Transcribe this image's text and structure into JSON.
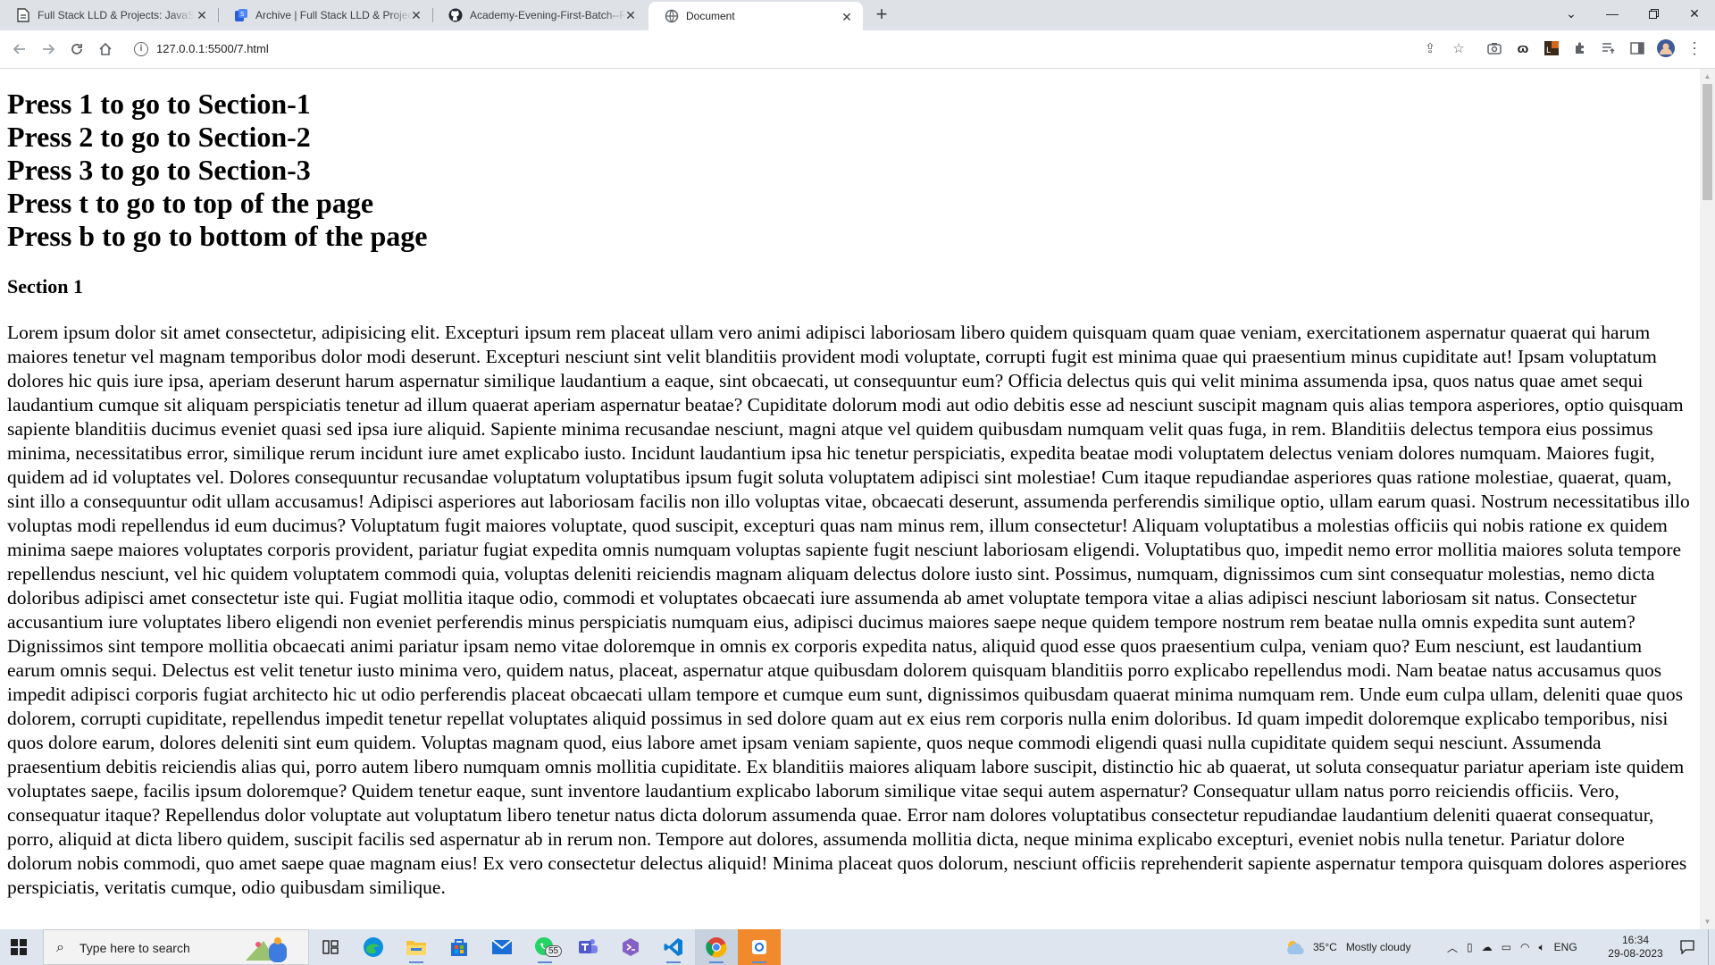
{
  "browser": {
    "tabs": [
      {
        "title": "Full Stack LLD & Projects: JavaScript",
        "icon": "document-icon",
        "active": false
      },
      {
        "title": "Archive | Full Stack LLD & Projects",
        "icon": "app-icon",
        "active": false
      },
      {
        "title": "Academy-Evening-First-Batch--Full",
        "icon": "github-icon",
        "active": false
      },
      {
        "title": "Document",
        "icon": "globe-icon",
        "active": true
      }
    ],
    "url": "127.0.0.1:5500/7.html"
  },
  "page": {
    "headings": [
      "Press 1 to go to Section-1",
      "Press 2 to go to Section-2",
      "Press 3 to go to Section-3",
      "Press t to go to top of the page",
      "Press b to go to bottom of the page"
    ],
    "section_title": "Section 1",
    "section_text": "Lorem ipsum dolor sit amet consectetur, adipisicing elit. Excepturi ipsum rem placeat ullam vero animi adipisci laboriosam libero quidem quisquam quam quae veniam, exercitationem aspernatur quaerat qui harum maiores tenetur vel magnam temporibus dolor modi deserunt. Excepturi nesciunt sint velit blanditiis provident modi voluptate, corrupti fugit est minima quae qui praesentium minus cupiditate aut! Ipsam voluptatum dolores hic quis iure ipsa, aperiam deserunt harum aspernatur similique laudantium a eaque, sint obcaecati, ut consequuntur eum? Officia delectus quis qui velit minima assumenda ipsa, quos natus quae amet sequi laudantium cumque sit aliquam perspiciatis tenetur ad illum quaerat aperiam aspernatur beatae? Cupiditate dolorum modi aut odio debitis esse ad nesciunt suscipit magnam quis alias tempora asperiores, optio quisquam sapiente blanditiis ducimus eveniet quasi sed ipsa iure aliquid. Sapiente minima recusandae nesciunt, magni atque vel quidem quibusdam numquam velit quas fuga, in rem. Blanditiis delectus tempora eius possimus minima, necessitatibus error, similique rerum incidunt iure amet explicabo iusto. Incidunt laudantium ipsa hic tenetur perspiciatis, expedita beatae modi voluptatem delectus veniam dolores numquam. Maiores fugit, quidem ad id voluptates vel. Dolores consequuntur recusandae voluptatum voluptatibus ipsum fugit soluta voluptatem adipisci sint molestiae! Cum itaque repudiandae asperiores quas ratione molestiae, quaerat, quam, sint illo a consequuntur odit ullam accusamus! Adipisci asperiores aut laboriosam facilis non illo voluptas vitae, obcaecati deserunt, assumenda perferendis similique optio, ullam earum quasi. Nostrum necessitatibus illo voluptas modi repellendus id eum ducimus? Voluptatum fugit maiores voluptate, quod suscipit, excepturi quas nam minus rem, illum consectetur! Aliquam voluptatibus a molestias officiis qui nobis ratione ex quidem minima saepe maiores voluptates corporis provident, pariatur fugiat expedita omnis numquam voluptas sapiente fugit nesciunt laboriosam eligendi. Voluptatibus quo, impedit nemo error mollitia maiores soluta tempore repellendus nesciunt, vel hic quidem voluptatem commodi quia, voluptas deleniti reiciendis magnam aliquam delectus dolore iusto sint. Possimus, numquam, dignissimos cum sint consequatur molestias, nemo dicta doloribus adipisci amet consectetur iste qui. Fugiat mollitia itaque odio, commodi et voluptates obcaecati iure assumenda ab amet voluptate tempora vitae a alias adipisci nesciunt laboriosam sit natus. Consectetur accusantium iure voluptates libero eligendi non eveniet perferendis minus perspiciatis numquam eius, adipisci ducimus maiores saepe neque quidem tempore nostrum rem beatae nulla omnis expedita sunt autem? Dignissimos sint tempore mollitia obcaecati animi pariatur ipsam nemo vitae doloremque in omnis ex corporis expedita natus, aliquid quod esse quos praesentium culpa, veniam quo? Eum nesciunt, est laudantium earum omnis sequi. Delectus est velit tenetur iusto minima vero, quidem natus, placeat, aspernatur atque quibusdam dolorem quisquam blanditiis porro explicabo repellendus modi. Nam beatae natus accusamus quos impedit adipisci corporis fugiat architecto hic ut odio perferendis placeat obcaecati ullam tempore et cumque eum sunt, dignissimos quibusdam quaerat minima numquam rem. Unde eum culpa ullam, deleniti quae quos dolorem, corrupti cupiditate, repellendus impedit tenetur repellat voluptates aliquid possimus in sed dolore quam aut ex eius rem corporis nulla enim doloribus. Id quam impedit doloremque explicabo temporibus, nisi quos dolore earum, dolores deleniti sint eum quidem. Voluptas magnam quod, eius labore amet ipsam veniam sapiente, quos neque commodi eligendi quasi nulla cupiditate quidem sequi nesciunt. Assumenda praesentium debitis reiciendis alias qui, porro autem libero numquam omnis mollitia cupiditate. Ex blanditiis maiores aliquam labore suscipit, distinctio hic ab quaerat, ut soluta consequatur pariatur aperiam iste quidem voluptates saepe, facilis ipsum doloremque? Quidem tenetur eaque, sunt inventore laudantium explicabo laborum similique vitae sequi autem aspernatur? Consequatur ullam natus porro reiciendis officiis. Vero, consequatur itaque? Repellendus dolor voluptate aut voluptatum libero tenetur natus dicta dolorum assumenda quae. Error nam dolores voluptatibus consectetur repudiandae laudantium deleniti quaerat consequatur, porro, aliquid at dicta libero quidem, suscipit facilis sed aspernatur ab in rerum non. Tempore aut dolores, assumenda mollitia dicta, neque minima explicabo excepturi, eveniet nobis nulla tenetur. Pariatur dolore dolorum nobis commodi, quo amet saepe quae magnam eius! Ex vero consectetur delectus aliquid! Minima placeat quos dolorum, nesciunt officiis reprehenderit sapiente aspernatur tempora quisquam dolores asperiores perspiciatis, veritatis cumque, odio quibusdam similique."
  },
  "taskbar": {
    "search_placeholder": "Type here to search",
    "apps": [
      "task-view-icon",
      "edge-icon",
      "file-explorer-icon",
      "store-icon",
      "mail-icon",
      "whatsapp-icon",
      "teams-icon",
      "visual-studio-icon",
      "vscode-icon",
      "chrome-icon",
      "app-icon"
    ],
    "whatsapp_badge": "55",
    "weather": {
      "temp": "35°C",
      "condition": "Mostly cloudy"
    },
    "language": "ENG",
    "time": "16:34",
    "date": "29-08-2023"
  }
}
